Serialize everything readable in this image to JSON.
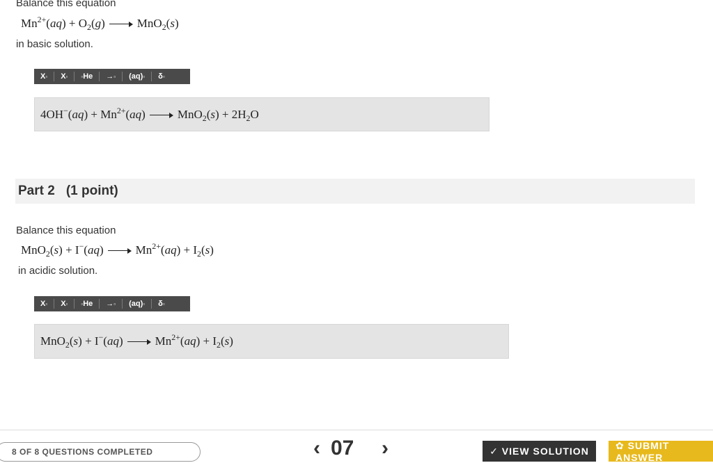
{
  "part1": {
    "intro": "Balance this equation",
    "condition": "in basic solution.",
    "answer_plain": "4OH⁻(aq) + Mn²⁺(aq) ⟶ MnO₂(s) + 2H₂O"
  },
  "toolbar": {
    "buttons": [
      "X",
      "X",
      "He",
      "→",
      "(aq)",
      "δ"
    ]
  },
  "part2": {
    "header_part": "Part 2",
    "header_points": "(1 point)",
    "intro": "Balance this equation",
    "condition": "in acidic solution.",
    "answer_plain": "MnO₂(s) + I⁻(aq) ⟶ Mn²⁺(aq) + I₂(s)"
  },
  "footer": {
    "progress": "8 OF 8 QUESTIONS COMPLETED",
    "prev": "‹",
    "page": "07",
    "next": "›",
    "view_solution": "✓ VIEW SOLUTION",
    "submit": "✿ SUBMIT ANSWER"
  },
  "colors": {
    "toolbar": "#4a4a4a",
    "answer_bg": "#e4e4e4",
    "part_header_bg": "#f2f2f2",
    "submit": "#e8b91c",
    "view_solution": "#333333"
  }
}
